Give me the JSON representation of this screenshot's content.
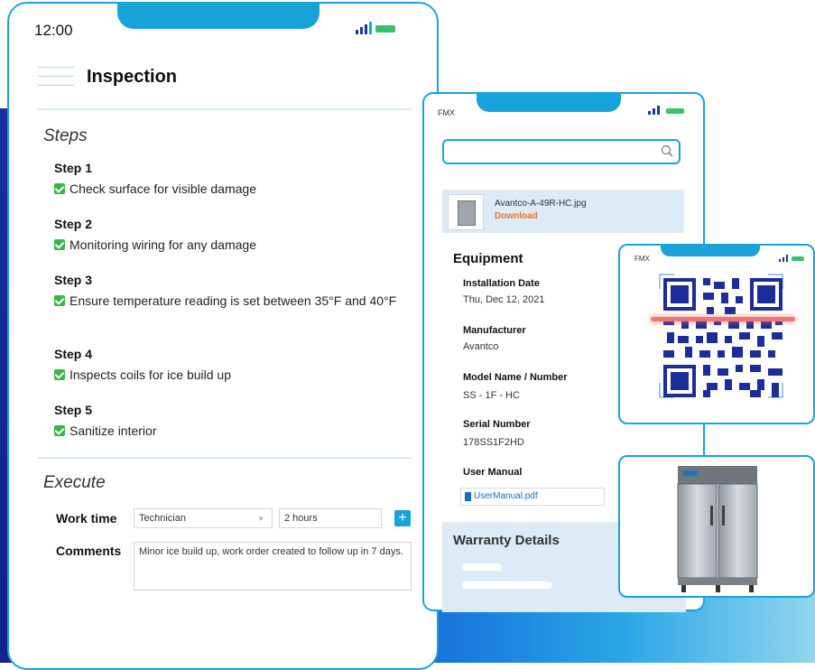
{
  "status_bar": {
    "time": "12:00"
  },
  "inspection": {
    "title": "Inspection",
    "steps_heading": "Steps",
    "steps": [
      {
        "label": "Step 1",
        "item": "Check surface for visible damage"
      },
      {
        "label": "Step 2",
        "item": "Monitoring wiring for any damage"
      },
      {
        "label": "Step 3",
        "item": "Ensure temperature reading is set between 35°F and 40°F"
      },
      {
        "label": "Step 4",
        "item": "Inspects coils for ice build up"
      },
      {
        "label": "Step 5",
        "item": "Sanitize interior"
      }
    ],
    "execute_heading": "Execute",
    "work_time_label": "Work time",
    "technician_value": "Technician",
    "hours_value": "2 hours",
    "add_label": "+",
    "comments_label": "Comments",
    "comments_value": "Minor ice build up, work order created to follow up in 7 days."
  },
  "equipment_app": {
    "brand": "FMX",
    "file_name": "Avantco-A-49R-HC.jpg",
    "download_label": "Download",
    "equipment_heading": "Equipment",
    "fields": [
      {
        "key": "Installation Date",
        "value": "Thu, Dec 12, 2021"
      },
      {
        "key": "Manufacturer",
        "value": "Avantco"
      },
      {
        "key": "Model Name / Number",
        "value": "SS - 1F - HC"
      },
      {
        "key": "Serial Number",
        "value": "178SS1F2HD"
      },
      {
        "key": "User Manual",
        "value": ""
      }
    ],
    "manual_file": "UserManual.pdf",
    "warranty_heading": "Warranty Details"
  },
  "qr_app": {
    "brand": "FMX"
  },
  "colors": {
    "accent": "#17a3d9",
    "check": "#39b54a",
    "download": "#e8742b",
    "navy": "#1a2d9a"
  }
}
